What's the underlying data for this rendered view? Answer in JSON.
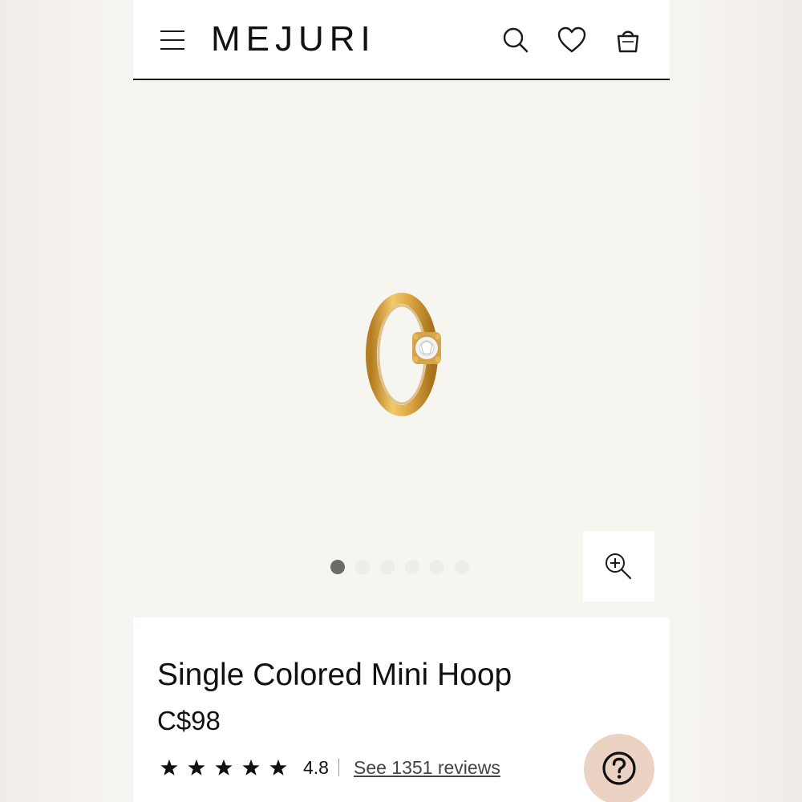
{
  "header": {
    "logo": "MEJURI",
    "icons": [
      "menu-icon",
      "search-icon",
      "heart-icon",
      "shopping-bag-icon"
    ]
  },
  "gallery": {
    "image_subject": "gold huggie hoop earring with single clear stone",
    "slide_count": 6,
    "active_slide": 1,
    "zoom_icon": "zoom-in-icon"
  },
  "product": {
    "title": "Single Colored Mini Hoop",
    "price": "C$98",
    "rating_value": "4.8",
    "rating_stars": 5,
    "reviews_link": "See 1351 reviews"
  },
  "help": {
    "icon": "question-icon"
  },
  "colors": {
    "gold": "#d9a441",
    "help_bg": "#ecd2c3",
    "text": "#111111"
  }
}
